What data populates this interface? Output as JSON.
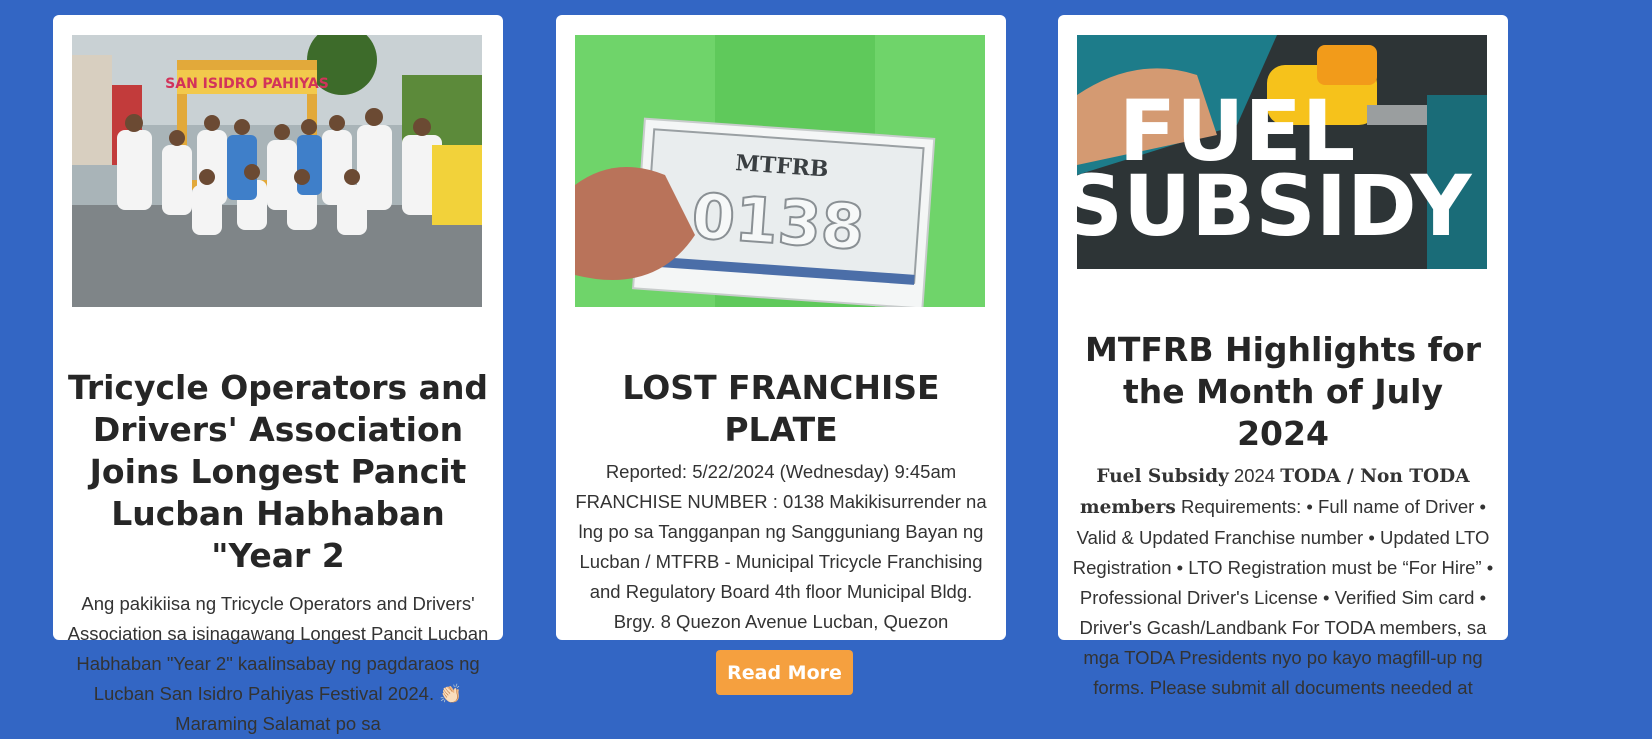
{
  "cards": [
    {
      "image_alt": "Group photo of tricycle operators and drivers in white shirts",
      "title": "Tricycle Operators and Drivers' Association Joins Longest Pancit Lucban Habhaban \"Year 2",
      "excerpt": "Ang pakikiisa ng Tricycle Operators and Drivers' Association sa isinagawang Longest Pancit Lucban Habhaban \"Year 2\" kaalinsabay ng pagdaraos ng Lucban San Isidro Pahiyas Festival 2024. 👏🏻 Maraming Salamat po sa",
      "arch_text": "SAN ISIDRO PAHIYAS"
    },
    {
      "image_alt": "Person holding an MTFRB franchise plate number 0138",
      "plate_org": "MTFRB",
      "plate_number": "0138",
      "title": "LOST FRANCHISE PLATE",
      "excerpt": "Reported: 5/22/2024 (Wednesday) 9:45am FRANCHISE NUMBER : 0138 Makikisurrender na lng po sa Tangganpan ng Sangguniang Bayan ng Lucban / MTFRB - Municipal Tricycle Franchising and Regulatory Board 4th floor Municipal Bldg. Brgy. 8 Quezon Avenue Lucban, Quezon"
    },
    {
      "image_alt": "Fuel nozzle with the words FUEL SUBSIDY",
      "image_word1": "FUEL",
      "image_word2": "SUBSIDY",
      "title": "MTFRB Highlights for the Month of July 2024",
      "excerpt_bold1": "Fuel Subsidy",
      "excerpt_year": " 2024 ",
      "excerpt_bold2": "TODA / Non TODA members",
      "excerpt_rest": " Requirements: • Full name of Driver • Valid & Updated Franchise number • Updated LTO Registration • LTO Registration must be “For Hire” • Professional Driver's License • Verified Sim card • Driver's Gcash/Landbank For TODA members, sa mga TODA Presidents nyo po kayo magfill-up ng forms. Please submit all documents needed at"
    }
  ],
  "read_more_label": "Read More",
  "colors": {
    "background": "#3366c4",
    "button": "#f5a03f",
    "card": "#ffffff"
  }
}
